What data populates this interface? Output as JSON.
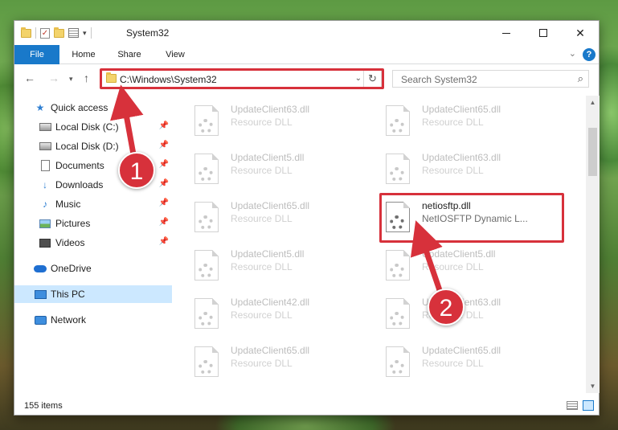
{
  "window": {
    "title": "System32",
    "ribbon_tabs": [
      "File",
      "Home",
      "Share",
      "View"
    ],
    "address_path": "C:\\Windows\\System32",
    "search_placeholder": "Search System32"
  },
  "nav_pane": {
    "quick_access_label": "Quick access",
    "quick_access_items": [
      {
        "label": "Local Disk (C:)",
        "icon": "drive-icon"
      },
      {
        "label": "Local Disk (D:)",
        "icon": "drive-icon"
      },
      {
        "label": "Documents",
        "icon": "documents-icon"
      },
      {
        "label": "Downloads",
        "icon": "downloads-icon"
      },
      {
        "label": "Music",
        "icon": "music-icon"
      },
      {
        "label": "Pictures",
        "icon": "pictures-icon"
      },
      {
        "label": "Videos",
        "icon": "videos-icon"
      }
    ],
    "onedrive": "OneDrive",
    "this_pc": "This PC",
    "network": "Network"
  },
  "files": [
    {
      "name": "UpdateClient63.dll",
      "type": "Resource DLL"
    },
    {
      "name": "UpdateClient65.dll",
      "type": "Resource DLL"
    },
    {
      "name": "UpdateClient5.dll",
      "type": "Resource DLL"
    },
    {
      "name": "UpdateClient63.dll",
      "type": "Resource DLL"
    },
    {
      "name": "UpdateClient65.dll",
      "type": "Resource DLL"
    },
    {
      "name": "netiosftp.dll",
      "type": "NetIOSFTP Dynamic L...",
      "highlighted": true
    },
    {
      "name": "UpdateClient5.dll",
      "type": "Resource DLL"
    },
    {
      "name": "UpdateClient5.dll",
      "type": "Resource DLL"
    },
    {
      "name": "UpdateClient42.dll",
      "type": "Resource DLL"
    },
    {
      "name": "UpdateClient63.dll",
      "type": "Resource DLL"
    },
    {
      "name": "UpdateClient65.dll",
      "type": "Resource DLL"
    },
    {
      "name": "UpdateClient65.dll",
      "type": "Resource DLL"
    }
  ],
  "status": {
    "item_count": "155 items"
  },
  "callouts": {
    "first": "1",
    "second": "2"
  },
  "colors": {
    "accent": "#1979ca",
    "highlight": "#d7313b",
    "selected_bg": "#cce8ff"
  }
}
